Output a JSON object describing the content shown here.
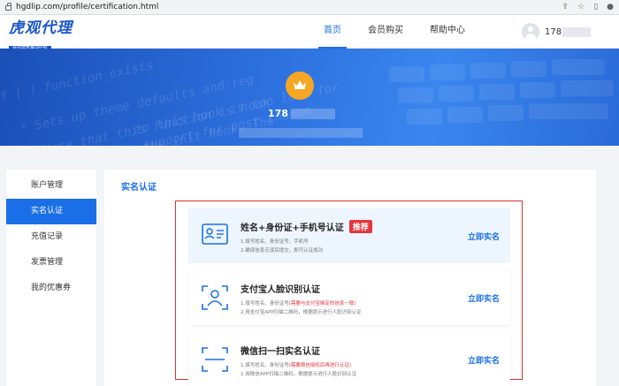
{
  "browser": {
    "url": "hgdlip.com/profile/certification.html"
  },
  "header": {
    "logo_title": "虎观代理",
    "logo_subtitle": "全国高质量IP代理",
    "nav": [
      "首页",
      "会员购买",
      "帮助中心"
    ],
    "user_prefix": "178"
  },
  "banner": {
    "code_lines": [
      "if ( ! function_exists",
      "* Sets up theme defaults and reg",
      "* Note that this function is hook",
      "runs before the init hook. The",
      "to this hook is too late for",
      "support for post thumbn"
    ],
    "user_prefix": "178"
  },
  "sidebar": {
    "items": [
      "账户管理",
      "实名认证",
      "充值记录",
      "发票管理",
      "我的优惠券"
    ]
  },
  "main": {
    "title": "实名认证",
    "cards": [
      {
        "title": "姓名+身份证+手机号认证",
        "tag": "推荐",
        "line1": "1.填写姓名、身份证号、手机号",
        "line1_note": "",
        "line2": "2.确保信息无误后提交，即可认证成功",
        "action": "立即实名"
      },
      {
        "title": "支付宝人脸识别认证",
        "tag": "",
        "line1": "1.填写姓名、身份证号",
        "line1_note": "(需要与支付宝绑定的信息一致)",
        "line2": "2.用支付宝APP扫描二维码，根据提示进行人脸识别认证",
        "action": "立即实名"
      },
      {
        "title": "微信扫一扫实名认证",
        "tag": "",
        "line1": "1.填写姓名、身份证号",
        "line1_note": "(需要微信授权后再进行认证)",
        "line2": "2.用微信APP扫描二维码，根据提示进行人脸识别认证",
        "action": "立即实名"
      }
    ]
  },
  "colors": {
    "primary": "#1a6fe8",
    "banner": "#2e72e0",
    "tag": "#e8333b",
    "crown": "#f5a623",
    "frame": "#d9322c"
  }
}
